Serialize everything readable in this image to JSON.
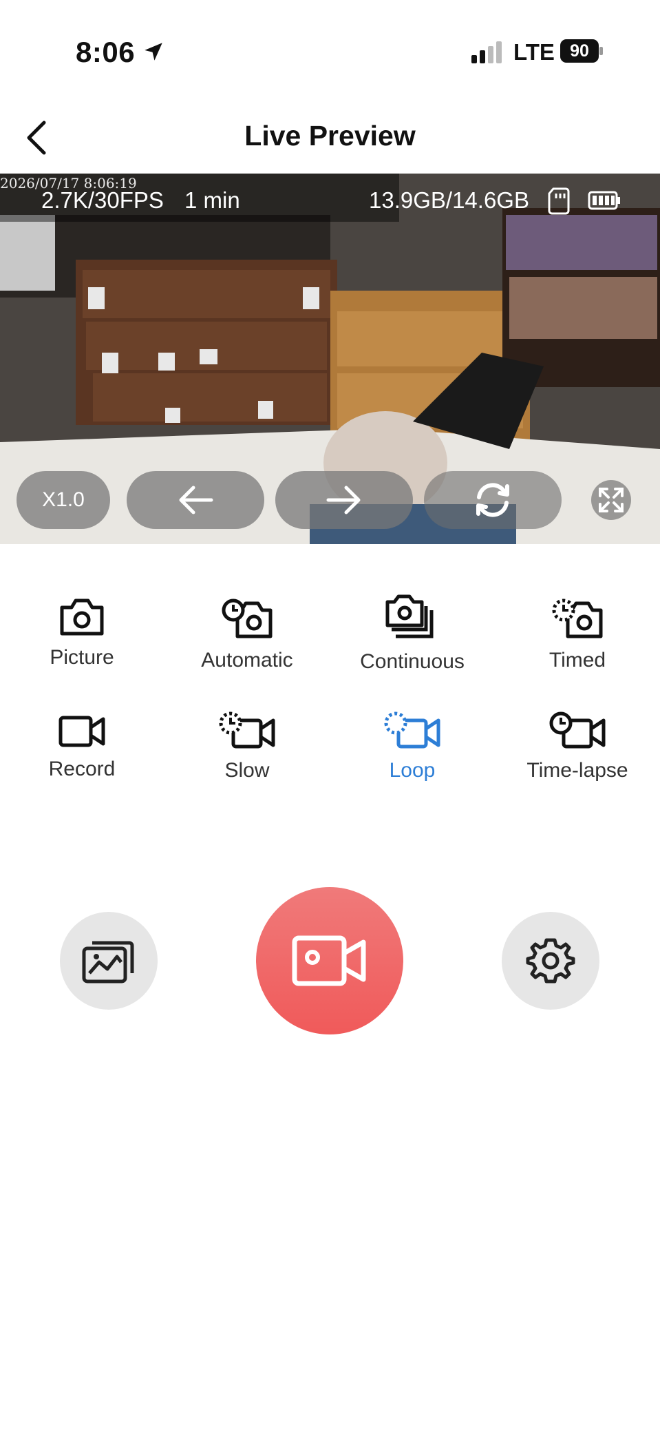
{
  "status_bar": {
    "time": "8:06",
    "network": "LTE",
    "battery_level": "90"
  },
  "header": {
    "title": "Live Preview"
  },
  "preview": {
    "timestamp": "2026/07/17 8:06:19",
    "resolution": "2.7K/30FPS",
    "duration": "1 min",
    "storage": "13.9GB/14.6GB",
    "zoom_label": "X1.0"
  },
  "modes": [
    {
      "label": "Picture",
      "icon": "camera-icon",
      "active": false
    },
    {
      "label": "Automatic",
      "icon": "auto-camera-icon",
      "active": false
    },
    {
      "label": "Continuous",
      "icon": "burst-camera-icon",
      "active": false
    },
    {
      "label": "Timed",
      "icon": "timer-camera-icon",
      "active": false
    },
    {
      "label": "Record",
      "icon": "video-icon",
      "active": false
    },
    {
      "label": "Slow",
      "icon": "slow-video-icon",
      "active": false
    },
    {
      "label": "Loop",
      "icon": "loop-video-icon",
      "active": true
    },
    {
      "label": "Time-lapse",
      "icon": "timelapse-video-icon",
      "active": false
    }
  ],
  "colors": {
    "accent": "#2d7ed6",
    "record": "#f06262",
    "secondary_button": "#e6e6e6"
  }
}
